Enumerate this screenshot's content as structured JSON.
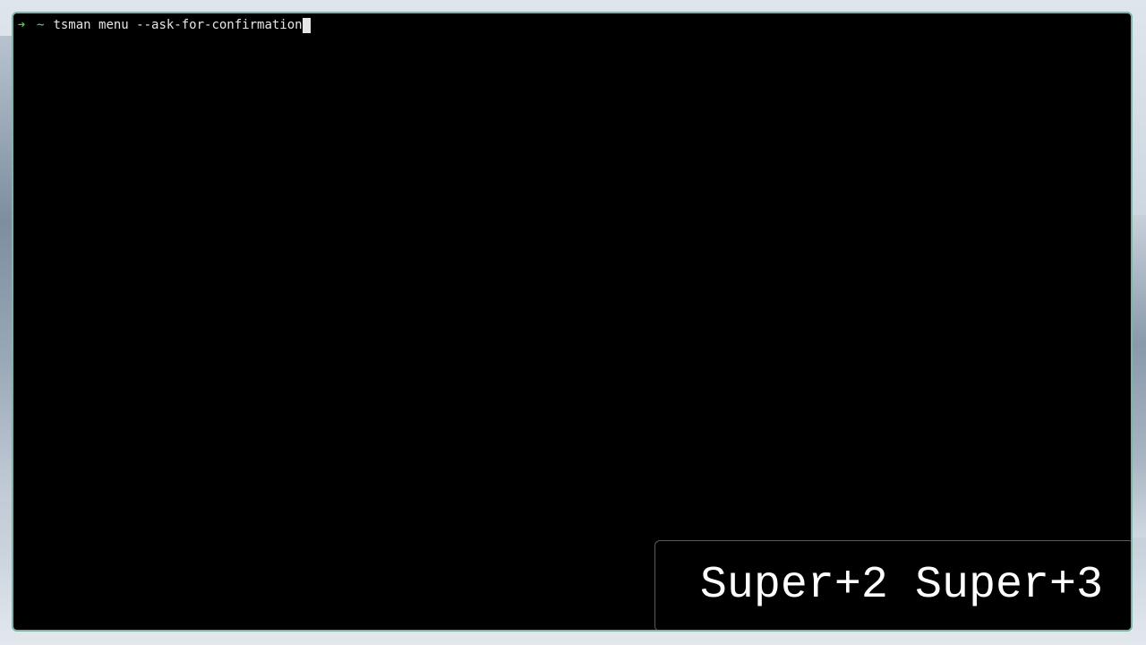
{
  "terminal": {
    "prompt_symbol": "➜",
    "directory": "~",
    "command": "tsman menu --ask-for-confirmation"
  },
  "keystroke_overlay": {
    "keys": [
      "Super+2",
      "Super+3"
    ]
  },
  "colors": {
    "terminal_background": "#000000",
    "terminal_border": "#7fb3a8",
    "prompt_arrow": "#3fcf4a",
    "prompt_directory": "#5fc6d6",
    "command_text": "#e6e6e6",
    "overlay_text": "#ffffff"
  }
}
